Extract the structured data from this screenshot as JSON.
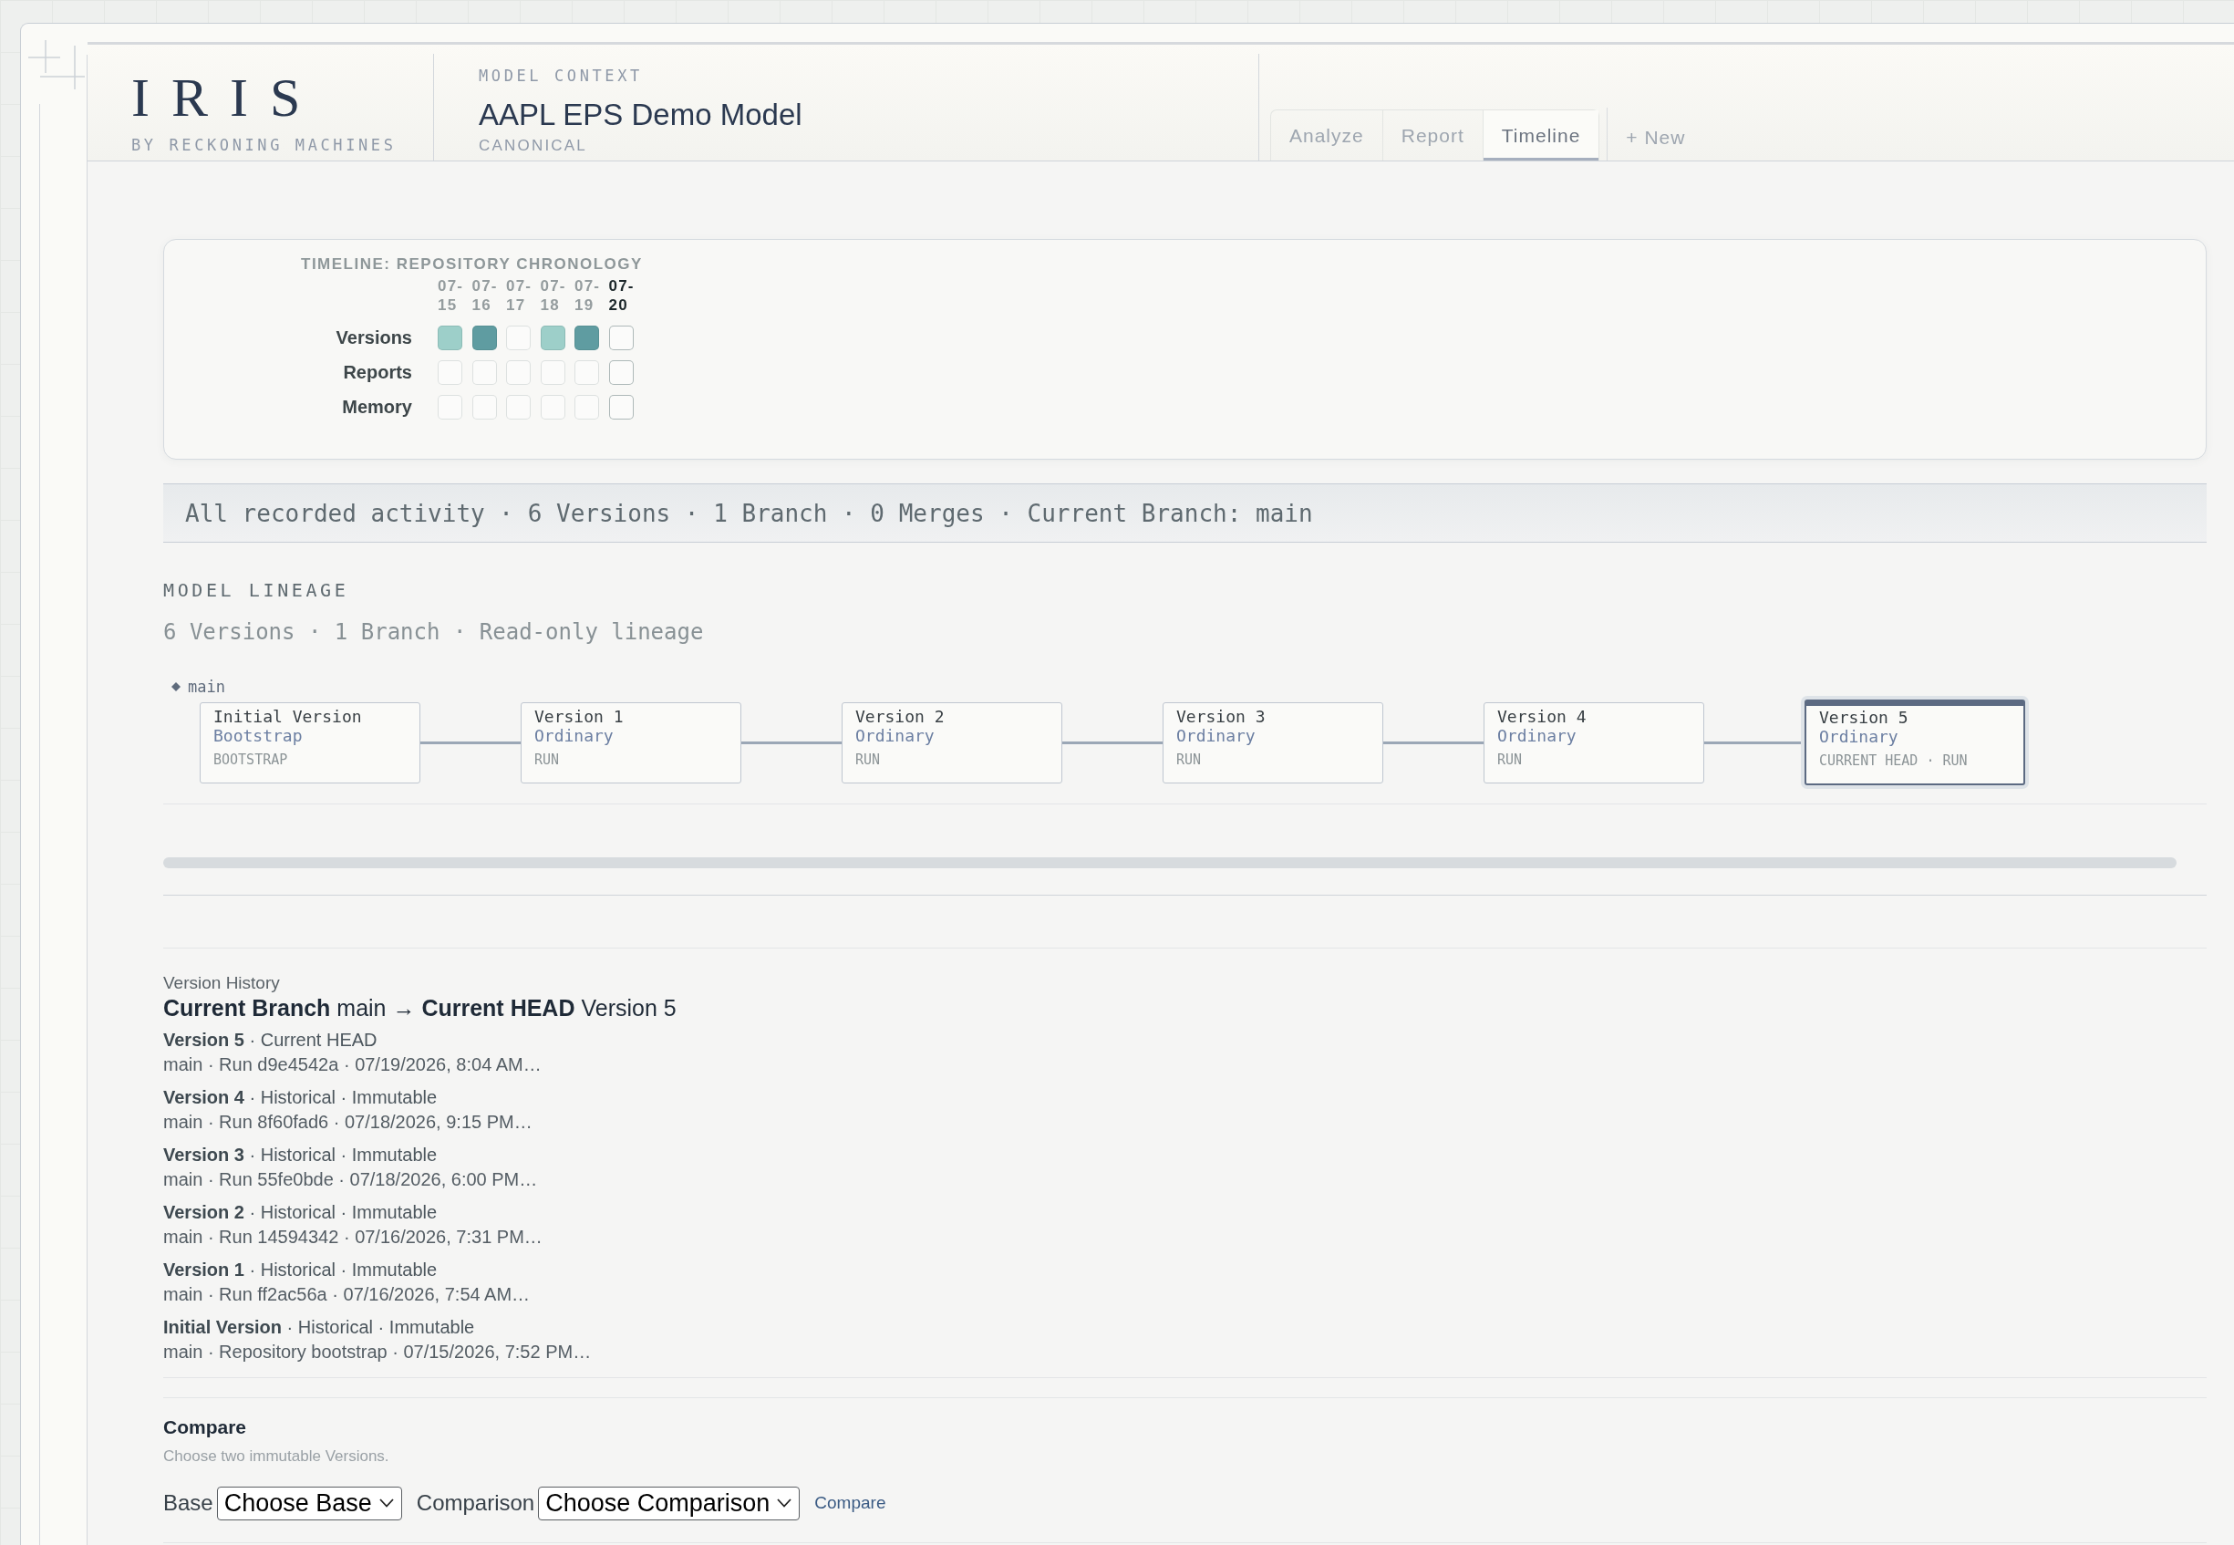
{
  "header": {
    "brand": {
      "logo": "IRIS",
      "tagline": "BY RECKONING MACHINES"
    },
    "context": {
      "label": "MODEL CONTEXT",
      "title": "AAPL EPS Demo Model",
      "subtitle": "CANONICAL"
    },
    "tabs": [
      {
        "label": "Analyze",
        "selected": false
      },
      {
        "label": "Report",
        "selected": false
      },
      {
        "label": "Timeline",
        "selected": true
      }
    ],
    "new_tab_button": "+ New"
  },
  "timeline": {
    "title": "TIMELINE: REPOSITORY CHRONOLOGY",
    "columns": [
      {
        "label": "07-15",
        "today": false
      },
      {
        "label": "07-16",
        "today": false
      },
      {
        "label": "07-17",
        "today": false
      },
      {
        "label": "07-18",
        "today": false
      },
      {
        "label": "07-19",
        "today": false
      },
      {
        "label": "07-20",
        "today": true
      }
    ],
    "rows": [
      {
        "label": "Versions",
        "cells": [
          {
            "color": "#9dcfc9"
          },
          {
            "color": "#5f9ca1"
          },
          {
            "color": "#fbfbfa"
          },
          {
            "color": "#9dcfc9"
          },
          {
            "color": "#5f9ca1"
          },
          {
            "color": "#fbfbfa"
          }
        ]
      },
      {
        "label": "Reports",
        "cells": [
          {
            "color": "#fbfbfa"
          },
          {
            "color": "#fbfbfa"
          },
          {
            "color": "#fbfbfa"
          },
          {
            "color": "#fbfbfa"
          },
          {
            "color": "#fbfbfa"
          },
          {
            "color": "#fbfbfa"
          }
        ]
      },
      {
        "label": "Memory",
        "cells": [
          {
            "color": "#fbfbfa"
          },
          {
            "color": "#fbfbfa"
          },
          {
            "color": "#fbfbfa"
          },
          {
            "color": "#fbfbfa"
          },
          {
            "color": "#fbfbfa"
          },
          {
            "color": "#fbfbfa"
          }
        ]
      }
    ]
  },
  "summary_bar": "All recorded activity · 6 Versions · 1 Branch · 0 Merges · Current Branch: main",
  "lineage": {
    "heading": "MODEL LINEAGE",
    "subheading": "6 Versions · 1 Branch · Read-only lineage",
    "branch": "main",
    "nodes": [
      {
        "title": "Initial Version",
        "type": "Bootstrap",
        "tag": "BOOTSTRAP",
        "current": false
      },
      {
        "title": "Version 1",
        "type": "Ordinary",
        "tag": "RUN",
        "current": false
      },
      {
        "title": "Version 2",
        "type": "Ordinary",
        "tag": "RUN",
        "current": false
      },
      {
        "title": "Version 3",
        "type": "Ordinary",
        "tag": "RUN",
        "current": false
      },
      {
        "title": "Version 4",
        "type": "Ordinary",
        "tag": "RUN",
        "current": false
      },
      {
        "title": "Version 5",
        "type": "Ordinary",
        "tag": "CURRENT HEAD · RUN",
        "current": true
      }
    ]
  },
  "history": {
    "label": "Version History",
    "heading": "**Current Branch** main → **Current HEAD** Version 5",
    "entries": [
      {
        "title": "**Version 5** · Current HEAD",
        "details": "main · Run d9e4542a · 07/19/2026, 8:04 AM…"
      },
      {
        "title": "**Version 4** · Historical · Immutable",
        "details": "main · Run 8f60fad6 · 07/18/2026, 9:15 PM…"
      },
      {
        "title": "**Version 3** · Historical · Immutable",
        "details": "main · Run 55fe0bde · 07/18/2026, 6:00 PM…"
      },
      {
        "title": "**Version 2** · Historical · Immutable",
        "details": "main · Run 14594342 · 07/16/2026, 7:31 PM…"
      },
      {
        "title": "**Version 1** · Historical · Immutable",
        "details": "main · Run ff2ac56a · 07/16/2026, 7:54 AM…"
      },
      {
        "title": "**Initial Version** · Historical · Immutable",
        "details": "main · Repository bootstrap · 07/15/2026, 7:52 PM…"
      }
    ]
  },
  "compare": {
    "title": "Compare",
    "hint": "Choose two immutable Versions.",
    "base_label": "Base",
    "base_select": "Choose Base",
    "comparison_label": "Comparison",
    "comparison_select": "Choose Comparison",
    "button": "Compare"
  }
}
